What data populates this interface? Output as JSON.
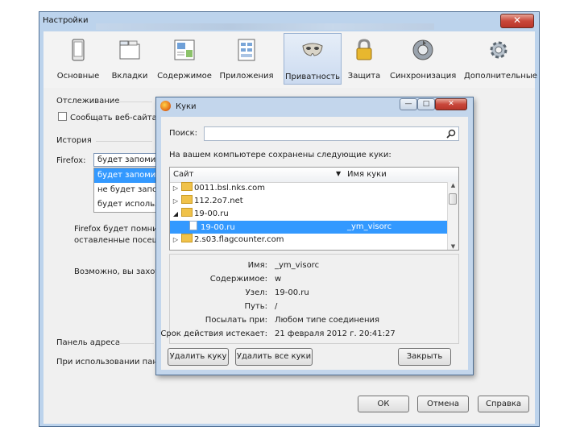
{
  "window": {
    "title": "Настройки",
    "close_glyph": "✕"
  },
  "toolbar": {
    "tabs": [
      {
        "label": "Основные",
        "icon": "device-icon"
      },
      {
        "label": "Вкладки",
        "icon": "tabs-icon"
      },
      {
        "label": "Содержимое",
        "icon": "content-icon"
      },
      {
        "label": "Приложения",
        "icon": "applications-icon"
      },
      {
        "label": "Приватность",
        "icon": "mask-icon"
      },
      {
        "label": "Защита",
        "icon": "padlock-icon"
      },
      {
        "label": "Синхронизация",
        "icon": "sync-icon"
      },
      {
        "label": "Дополнительные",
        "icon": "gear-icon"
      }
    ],
    "active_tab": "Приватность"
  },
  "privacy": {
    "tracking_heading": "Отслеживание",
    "tracking_checkbox": "Сообщать веб-сайтам",
    "history_heading": "История",
    "firefox_label": "Firefox:",
    "history_combo_value": "будет запоминать",
    "history_options": [
      "будет запоминать",
      "не будет запоминать",
      "будет использовать"
    ],
    "history_note_1": "Firefox будет помнит",
    "history_note_2": "оставленные посещ",
    "history_note_3": "Возможно, вы захоте",
    "address_bar_heading": "Панель адреса",
    "address_bar_text": "При использовании пане"
  },
  "footer": {
    "ok": "ОК",
    "cancel": "Отмена",
    "help": "Справка"
  },
  "cookies_dialog": {
    "title": "Куки",
    "search_label": "Поиск:",
    "search_value": "",
    "stored_label": "На вашем компьютере сохранены следующие куки:",
    "col_site": "Сайт",
    "col_name": "Имя куки",
    "rows": [
      {
        "expander": "▷",
        "site": "0011.bsl.nks.com",
        "name": "",
        "type": "folder"
      },
      {
        "expander": "▷",
        "site": "112.2o7.net",
        "name": "",
        "type": "folder"
      },
      {
        "expander": "◢",
        "site": "19-00.ru",
        "name": "",
        "type": "folder"
      },
      {
        "expander": "",
        "site": "19-00.ru",
        "name": "_ym_visorc",
        "type": "cookie"
      },
      {
        "expander": "▷",
        "site": "2.s03.flagcounter.com",
        "name": "",
        "type": "folder"
      }
    ],
    "selected_row": 3,
    "details": [
      {
        "label": "Имя:",
        "value": "_ym_visorc"
      },
      {
        "label": "Содержимое:",
        "value": "w"
      },
      {
        "label": "Узел:",
        "value": "19-00.ru"
      },
      {
        "label": "Путь:",
        "value": "/"
      },
      {
        "label": "Посылать при:",
        "value": "Любом типе соединения"
      },
      {
        "label": "Срок действия истекает:",
        "value": "21 февраля 2012 г. 20:41:27"
      }
    ],
    "buttons": {
      "remove": "Удалить куку",
      "remove_all": "Удалить все куки",
      "close": "Закрыть"
    },
    "window_buttons": {
      "minimize": "—",
      "maximize": "□",
      "close": "✕"
    }
  },
  "colors": {
    "accent": "#3399ff",
    "frame": "#bcd3ec",
    "close": "#c9473a"
  }
}
